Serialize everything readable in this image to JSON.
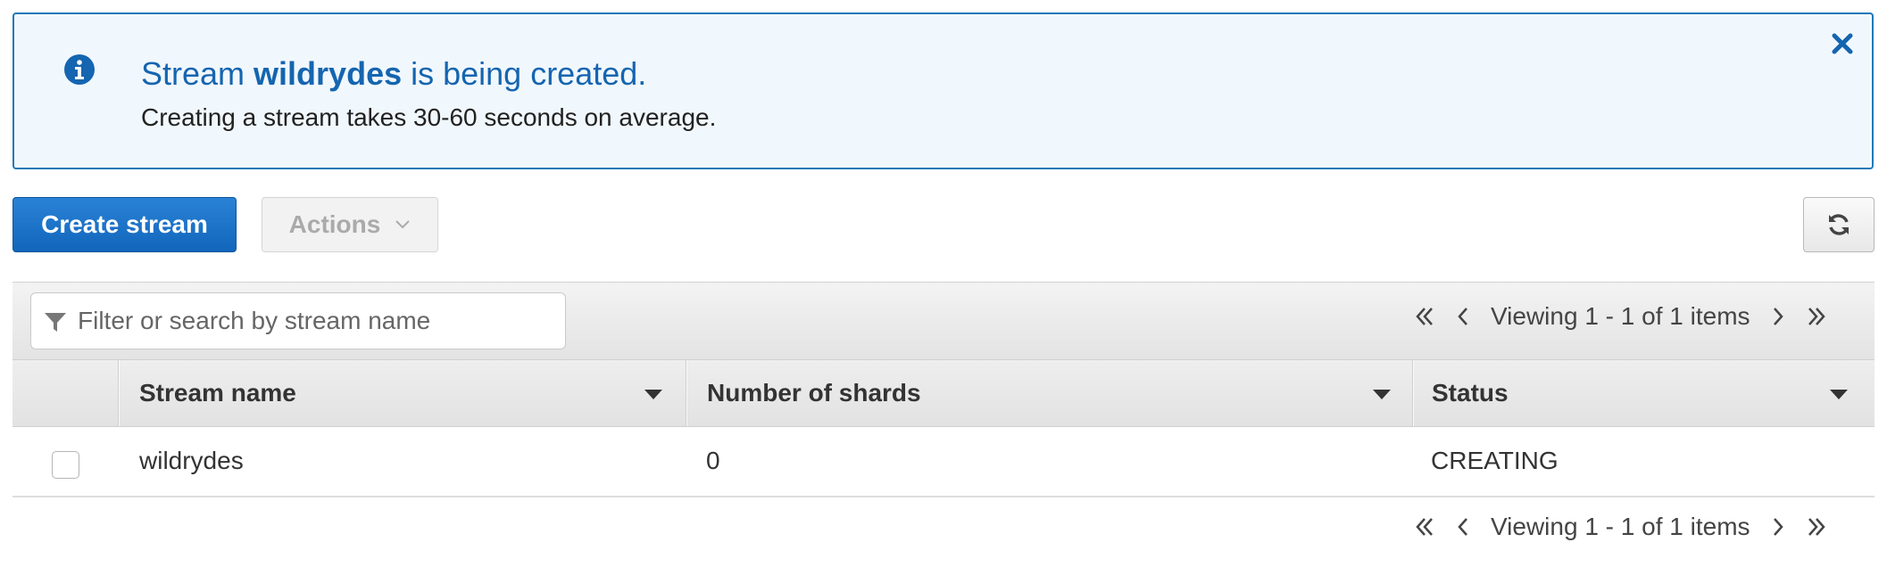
{
  "banner": {
    "title_prefix": "Stream ",
    "stream_name": "wildrydes",
    "title_suffix": " is being created.",
    "subtitle": "Creating a stream takes 30-60 seconds on average.",
    "info_icon": "info-circle-icon",
    "close_icon": "close-icon"
  },
  "toolbar": {
    "create_label": "Create stream",
    "actions_label": "Actions",
    "refresh_icon": "refresh-icon"
  },
  "filter": {
    "placeholder": "Filter or search by stream name",
    "value": ""
  },
  "pagination": {
    "text": "Viewing 1 - 1 of 1 items"
  },
  "table": {
    "columns": [
      {
        "label": "Stream name"
      },
      {
        "label": "Number of shards"
      },
      {
        "label": "Status"
      }
    ],
    "rows": [
      {
        "stream_name": "wildrydes",
        "shards": "0",
        "status": "CREATING",
        "selected": false
      }
    ]
  },
  "colors": {
    "banner_bg": "#f1f8fd",
    "banner_border": "#1e79b8",
    "banner_text": "#1565b0",
    "primary_button": "#1a73c8"
  }
}
